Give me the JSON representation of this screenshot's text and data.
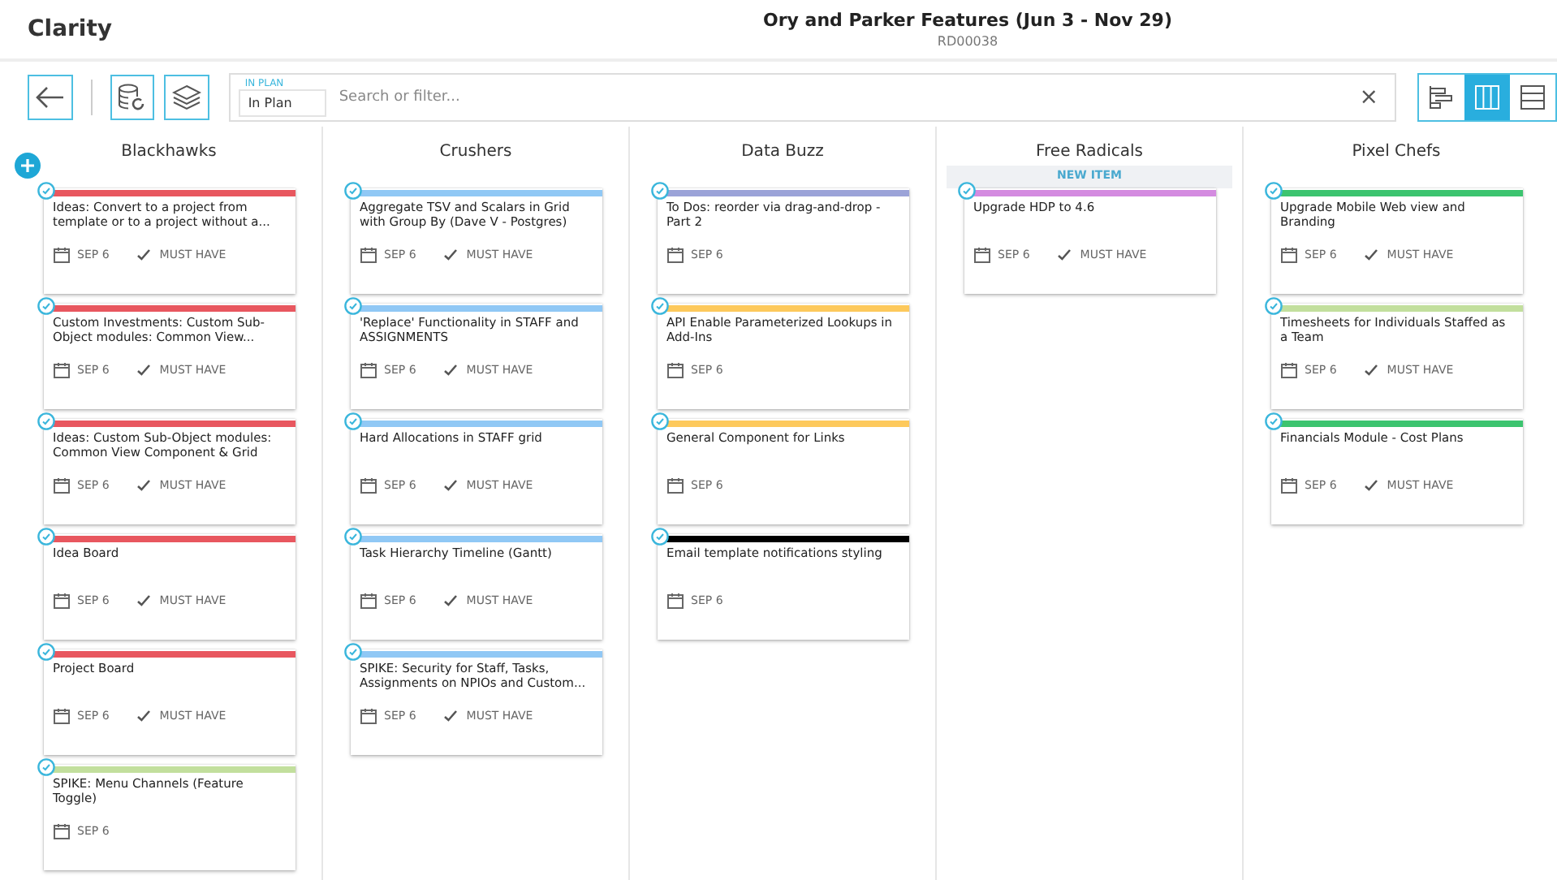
{
  "app": {
    "name": "Clarity"
  },
  "header": {
    "title": "Ory and Parker Features (Jun 3 - Nov 29)",
    "code": "RD00038"
  },
  "filter": {
    "label": "IN PLAN",
    "value": "In Plan",
    "placeholder": "Search or filter...",
    "clear": "×"
  },
  "views": [
    {
      "kind": "timeline",
      "selected": false
    },
    {
      "kind": "board",
      "selected": true
    },
    {
      "kind": "list",
      "selected": false
    }
  ],
  "columns": [
    {
      "name": "Blackhawks",
      "cards": [
        {
          "title": "Ideas: Convert to a project from template or to a project without a...",
          "color": "#e8575f",
          "date": "SEP 6",
          "priority": "MUST HAVE"
        },
        {
          "title": "Custom Investments: Custom Sub-Object modules: Common View...",
          "color": "#e8575f",
          "date": "SEP 6",
          "priority": "MUST HAVE"
        },
        {
          "title": "Ideas: Custom Sub-Object modules: Common View Component & Grid",
          "color": "#e8575f",
          "date": "SEP 6",
          "priority": "MUST HAVE"
        },
        {
          "title": "Idea Board",
          "color": "#e8575f",
          "date": "SEP 6",
          "priority": "MUST HAVE"
        },
        {
          "title": "Project Board",
          "color": "#e8575f",
          "date": "SEP 6",
          "priority": "MUST HAVE"
        },
        {
          "title": "SPIKE: Menu Channels (Feature Toggle)",
          "color": "#c2df9d",
          "date": "SEP 6"
        }
      ]
    },
    {
      "name": "Crushers",
      "cards": [
        {
          "title": "Aggregate TSV and Scalars in Grid with Group By (Dave V - Postgres)",
          "color": "#90c8f5",
          "date": "SEP 6",
          "priority": "MUST HAVE"
        },
        {
          "title": "'Replace' Functionality in STAFF and ASSIGNMENTS",
          "color": "#90c8f5",
          "date": "SEP 6",
          "priority": "MUST HAVE"
        },
        {
          "title": "Hard Allocations in STAFF grid",
          "color": "#90c8f5",
          "date": "SEP 6",
          "priority": "MUST HAVE"
        },
        {
          "title": "Task Hierarchy Timeline (Gantt)",
          "color": "#90c8f5",
          "date": "SEP 6",
          "priority": "MUST HAVE"
        },
        {
          "title": "SPIKE: Security for Staff, Tasks, Assignments on NPIOs and Custom...",
          "color": "#90c8f5",
          "date": "SEP 6",
          "priority": "MUST HAVE"
        }
      ]
    },
    {
      "name": "Data Buzz",
      "cards": [
        {
          "title": "To Dos: reorder via drag-and-drop - Part 2",
          "color": "#9ba3d8",
          "date": "SEP 6"
        },
        {
          "title": "API Enable Parameterized Lookups in Add-Ins",
          "color": "#fdc95c",
          "date": "SEP 6"
        },
        {
          "title": "General Component for Links",
          "color": "#fdc95c",
          "date": "SEP 6"
        },
        {
          "title": "Email template notifications styling",
          "color": "#000000",
          "date": "SEP 6"
        }
      ]
    },
    {
      "name": "Free Radicals",
      "new_item": "NEW ITEM",
      "cards": [
        {
          "title": "Upgrade HDP to 4.6",
          "color": "#d48be0",
          "date": "SEP 6",
          "priority": "MUST HAVE"
        }
      ]
    },
    {
      "name": "Pixel Chefs",
      "cards": [
        {
          "title": "Upgrade Mobile Web view and Branding",
          "color": "#3cc46f",
          "date": "SEP 6",
          "priority": "MUST HAVE"
        },
        {
          "title": "Timesheets for Individuals Staffed as a Team",
          "color": "#c2df9d",
          "date": "SEP 6",
          "priority": "MUST HAVE"
        },
        {
          "title": "Financials Module - Cost Plans",
          "color": "#3cc46f",
          "date": "SEP 6",
          "priority": "MUST HAVE"
        }
      ]
    }
  ]
}
